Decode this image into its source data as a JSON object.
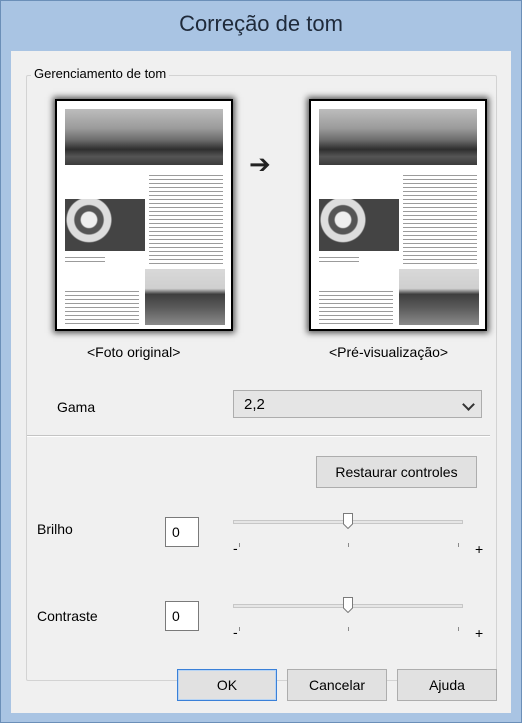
{
  "window": {
    "title": "Correção de tom"
  },
  "group": {
    "legend": "Gerenciamento de tom",
    "original_caption": "<Foto original>",
    "preview_caption": "<Pré-visualização>"
  },
  "gamma": {
    "label": "Gama",
    "value": "2,2"
  },
  "reset_label": "Restaurar controles",
  "brightness": {
    "label": "Brilho",
    "value": "0",
    "minus": "-",
    "plus": "+",
    "level": 0.5
  },
  "contrast": {
    "label": "Contraste",
    "value": "0",
    "minus": "-",
    "plus": "+",
    "level": 0.5
  },
  "buttons": {
    "ok": "OK",
    "cancel": "Cancelar",
    "help": "Ajuda"
  },
  "icons": {
    "arrow": "right-arrow-icon",
    "dropdown": "chevron-down-icon",
    "thumb": "slider-thumb-icon"
  },
  "colors": {
    "title_bar": "#a9c4e3",
    "client": "#f0f0f0",
    "default_button_border": "#3a80d8"
  }
}
